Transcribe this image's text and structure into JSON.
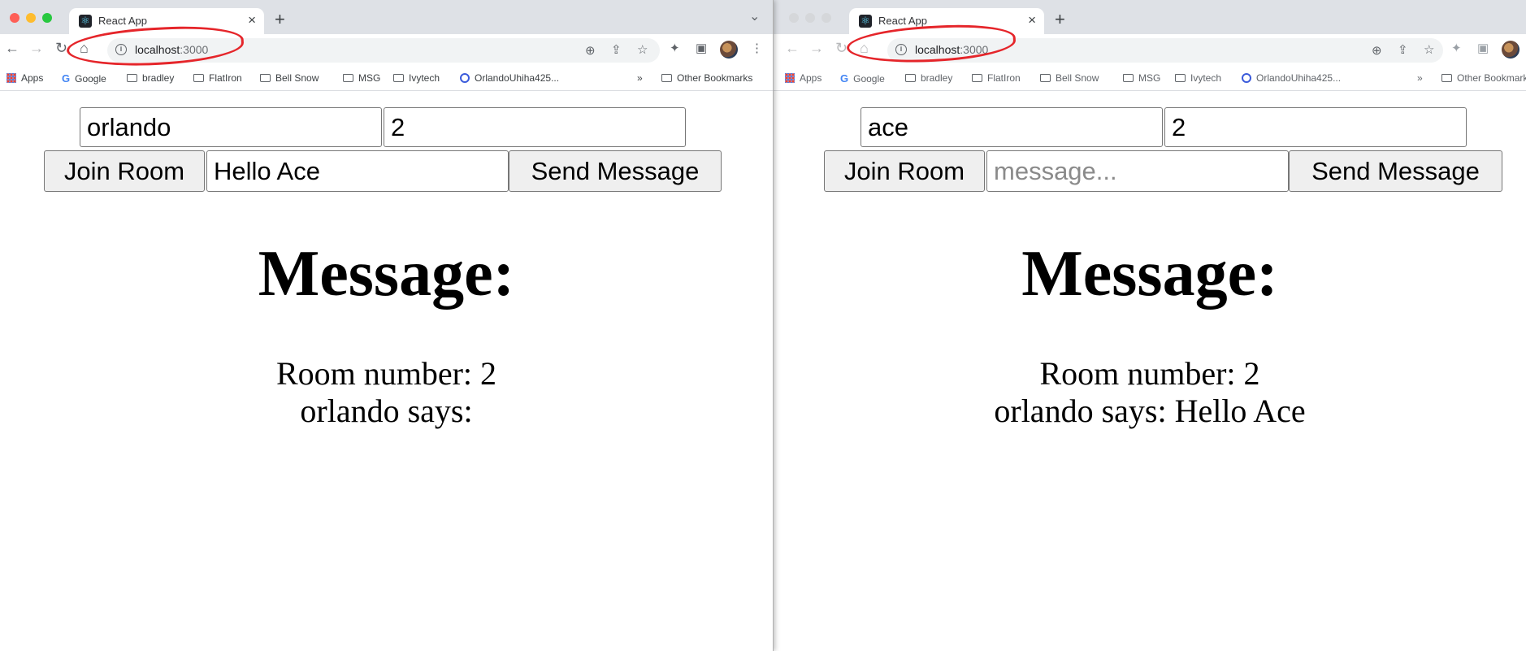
{
  "browser": {
    "tab_title": "React App",
    "url_host": "localhost",
    "url_port": ":3000",
    "bookmarks": [
      "Apps",
      "Google",
      "bradley",
      "FlatIron",
      "Bell Snow",
      "MSG",
      "Ivytech",
      "OrlandoUhiha425...",
      "Other Bookmarks"
    ]
  },
  "left": {
    "name_value": "orlando",
    "room_value": "2",
    "join_label": "Join Room",
    "message_value": "Hello Ace",
    "message_placeholder": "message...",
    "send_label": "Send Message",
    "heading": "Message:",
    "room_line": "Room number: 2",
    "says_line": "orlando says:"
  },
  "right": {
    "name_value": "ace",
    "room_value": "2",
    "join_label": "Join Room",
    "message_value": "",
    "message_placeholder": "message...",
    "send_label": "Send Message",
    "heading": "Message:",
    "room_line": "Room number: 2",
    "says_line": "orlando says: Hello Ace"
  },
  "colors": {
    "annotation": "#e5252a",
    "tabstrip": "#dee1e6",
    "button_bg": "#efefef"
  }
}
